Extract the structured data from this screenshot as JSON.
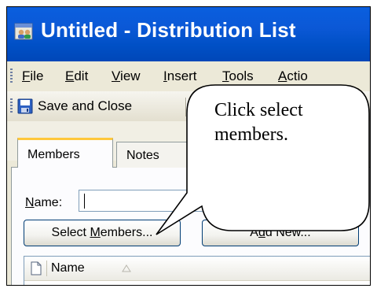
{
  "window": {
    "title": "Untitled - Distribution List"
  },
  "menu": {
    "items": [
      "File",
      "Edit",
      "View",
      "Insert",
      "Tools",
      "Actio"
    ]
  },
  "toolbar": {
    "save_label": "Save and Close"
  },
  "tabs": [
    {
      "label": "Members"
    },
    {
      "label": "Notes"
    }
  ],
  "form": {
    "name_label": "Name:",
    "name_value": "",
    "select_members_label": "Select Members...",
    "add_new_label": "Add New..."
  },
  "list": {
    "columns": [
      {
        "label": "Name"
      }
    ]
  },
  "callout": {
    "line1": "Click select",
    "line2": "members."
  },
  "colors": {
    "titlebar": "#0050c6",
    "accent_tab": "#ffc83c",
    "chrome": "#ece9d8"
  }
}
